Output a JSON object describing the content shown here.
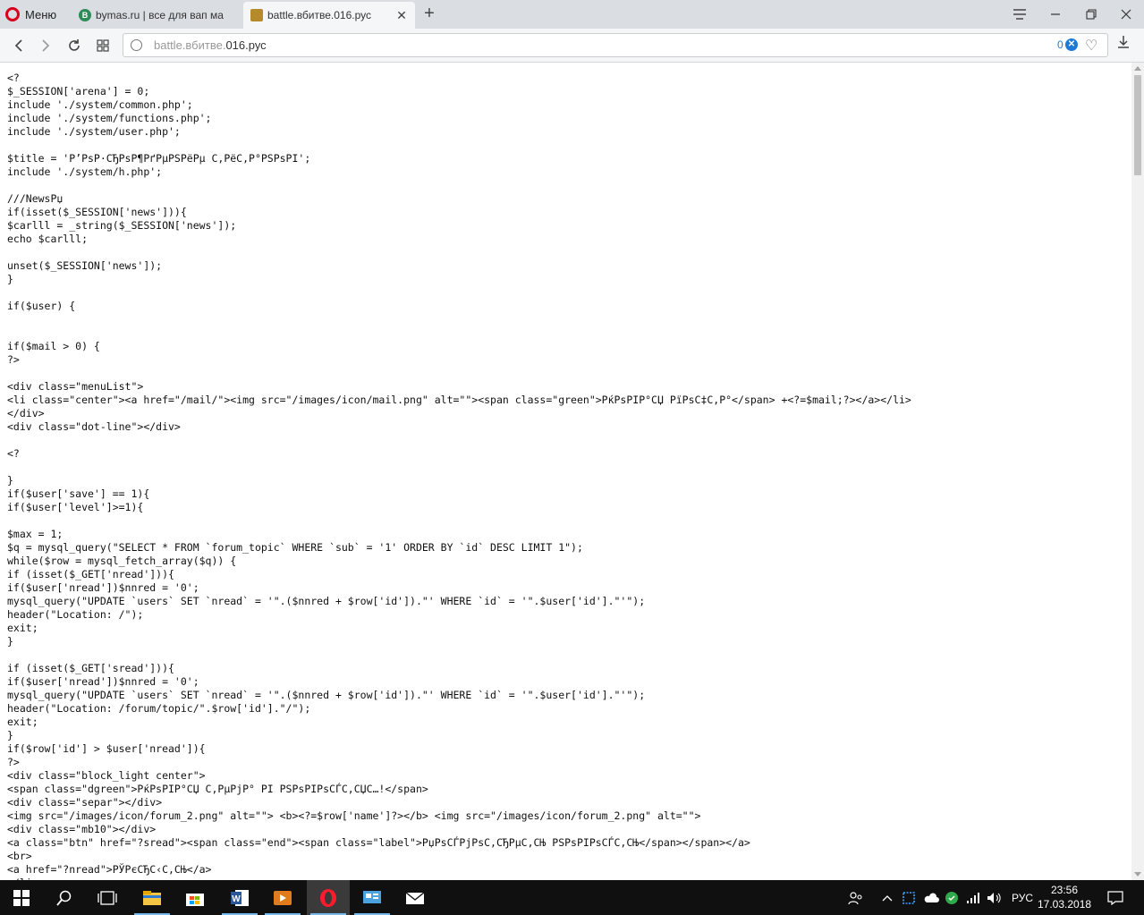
{
  "browser": {
    "menu_label": "Меню",
    "tabs": [
      {
        "title": "bymas.ru | все для вап ма",
        "favicon_letter": "B",
        "favicon_color": "#2e8b57",
        "active": false
      },
      {
        "title": "battle.вбитве.016.рус",
        "favicon_letter": "",
        "favicon_color": "#b58a2b",
        "active": true
      }
    ],
    "new_tab": "+",
    "address": {
      "scheme_dim": "battle.вбитве.",
      "host": "016.рус",
      "adblock_count": "0"
    },
    "colors": {
      "accent": "#d9001b",
      "link": "#1e7ad8"
    }
  },
  "code_lines": [
    "<?",
    "$_SESSION['arena'] = 0;",
    "include './system/common.php';",
    "include './system/functions.php';",
    "include './system/user.php';",
    "",
    "$title = 'Р’РѕР·СЂРѕР¶РґРµРЅРёРµ С‚РёС‚Р°РЅРѕРІ';",
    "include './system/h.php';",
    "",
    "///NewsРџ",
    "if(isset($_SESSION['news'])){",
    "$carlll = _string($_SESSION['news']);",
    "echo $carlll;",
    "",
    "unset($_SESSION['news']);",
    "}",
    "",
    "if($user) {",
    "",
    "",
    "if($mail > 0) {",
    "?>",
    "",
    "<div class=\"menuList\">",
    "<li class=\"center\"><a href=\"/mail/\"><img src=\"/images/icon/mail.png\" alt=\"\"><span class=\"green\">РќРѕРІР°СЏ РїРѕС‡С‚Р°</span> +<?=$mail;?></a></li>",
    "</div>",
    "<div class=\"dot-line\"></div>",
    "",
    "<?",
    "",
    "}",
    "if($user['save'] == 1){",
    "if($user['level']>=1){",
    "",
    "$max = 1;",
    "$q = mysql_query(\"SELECT * FROM `forum_topic` WHERE `sub` = '1' ORDER BY `id` DESC LIMIT 1\");",
    "while($row = mysql_fetch_array($q)) {",
    "if (isset($_GET['nread'])){",
    "if($user['nread'])$nnred = '0';",
    "mysql_query(\"UPDATE `users` SET `nread` = '\".($nnred + $row['id']).\"' WHERE `id` = '\".$user['id'].\"'\");",
    "header(\"Location: /\");",
    "exit;",
    "}",
    "",
    "if (isset($_GET['sread'])){",
    "if($user['nread'])$nnred = '0';",
    "mysql_query(\"UPDATE `users` SET `nread` = '\".($nnred + $row['id']).\"' WHERE `id` = '\".$user['id'].\"'\");",
    "header(\"Location: /forum/topic/\".$row['id'].\"/\");",
    "exit;",
    "}",
    "if($row['id'] > $user['nread']){",
    "?>",
    "<div class=\"block_light center\">",
    "<span class=\"dgreen\">РќРѕРІР°СЏ С‚РµРјР° РІ РЅРѕРІРѕСЃС‚СЏС…!</span>",
    "<div class=\"separ\"></div>",
    "<img src=\"/images/icon/forum_2.png\" alt=\"\"> <b><?=$row['name']?></b> <img src=\"/images/icon/forum_2.png\" alt=\"\">",
    "<div class=\"mb10\"></div>",
    "<a class=\"btn\" href=\"?sread\"><span class=\"end\"><span class=\"label\">РџРѕСЃРјРѕС‚СЂРµС‚СЊ РЅРѕРІРѕСЃС‚СЊ</span></span></a>",
    "<br>",
    "<a href=\"?nread\">РЎРєСЂС‹С‚СЊ</a>",
    "</li>"
  ],
  "taskbar": {
    "lang": "РУС",
    "time": "23:56",
    "date": "17.03.2018"
  }
}
